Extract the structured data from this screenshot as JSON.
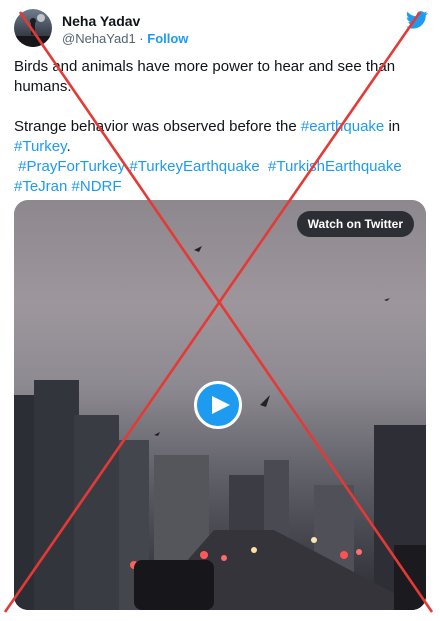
{
  "author": {
    "name": "Neha Yadav",
    "handle": "@NehaYad1",
    "separator": "·",
    "follow_label": "Follow"
  },
  "icons": {
    "brand": "twitter-bird-icon",
    "play": "play-icon",
    "overlay": "red-cross-mark"
  },
  "tweet": {
    "line1": "Birds and animals have more power to hear and see than humans.",
    "line2_text": "Strange behavior was observed before the",
    "tag_earthquake": "#earthquake",
    "in_text": "in",
    "tag_turkey": "#Turkey",
    "period": ".",
    "tag_prayforturkey": "#PrayForTurkey",
    "tag_turkeyearthquake": "#TurkeyEarthquake",
    "tag_turkishearthquake": "#TurkishEarthquake",
    "tag_tejran": "#TeJran",
    "tag_ndrf": "#NDRF"
  },
  "media": {
    "watch_label": "Watch on Twitter"
  },
  "colors": {
    "link": "#1d9bf0",
    "text": "#0f1419",
    "secondary": "#536471",
    "cross": "#e53935"
  }
}
